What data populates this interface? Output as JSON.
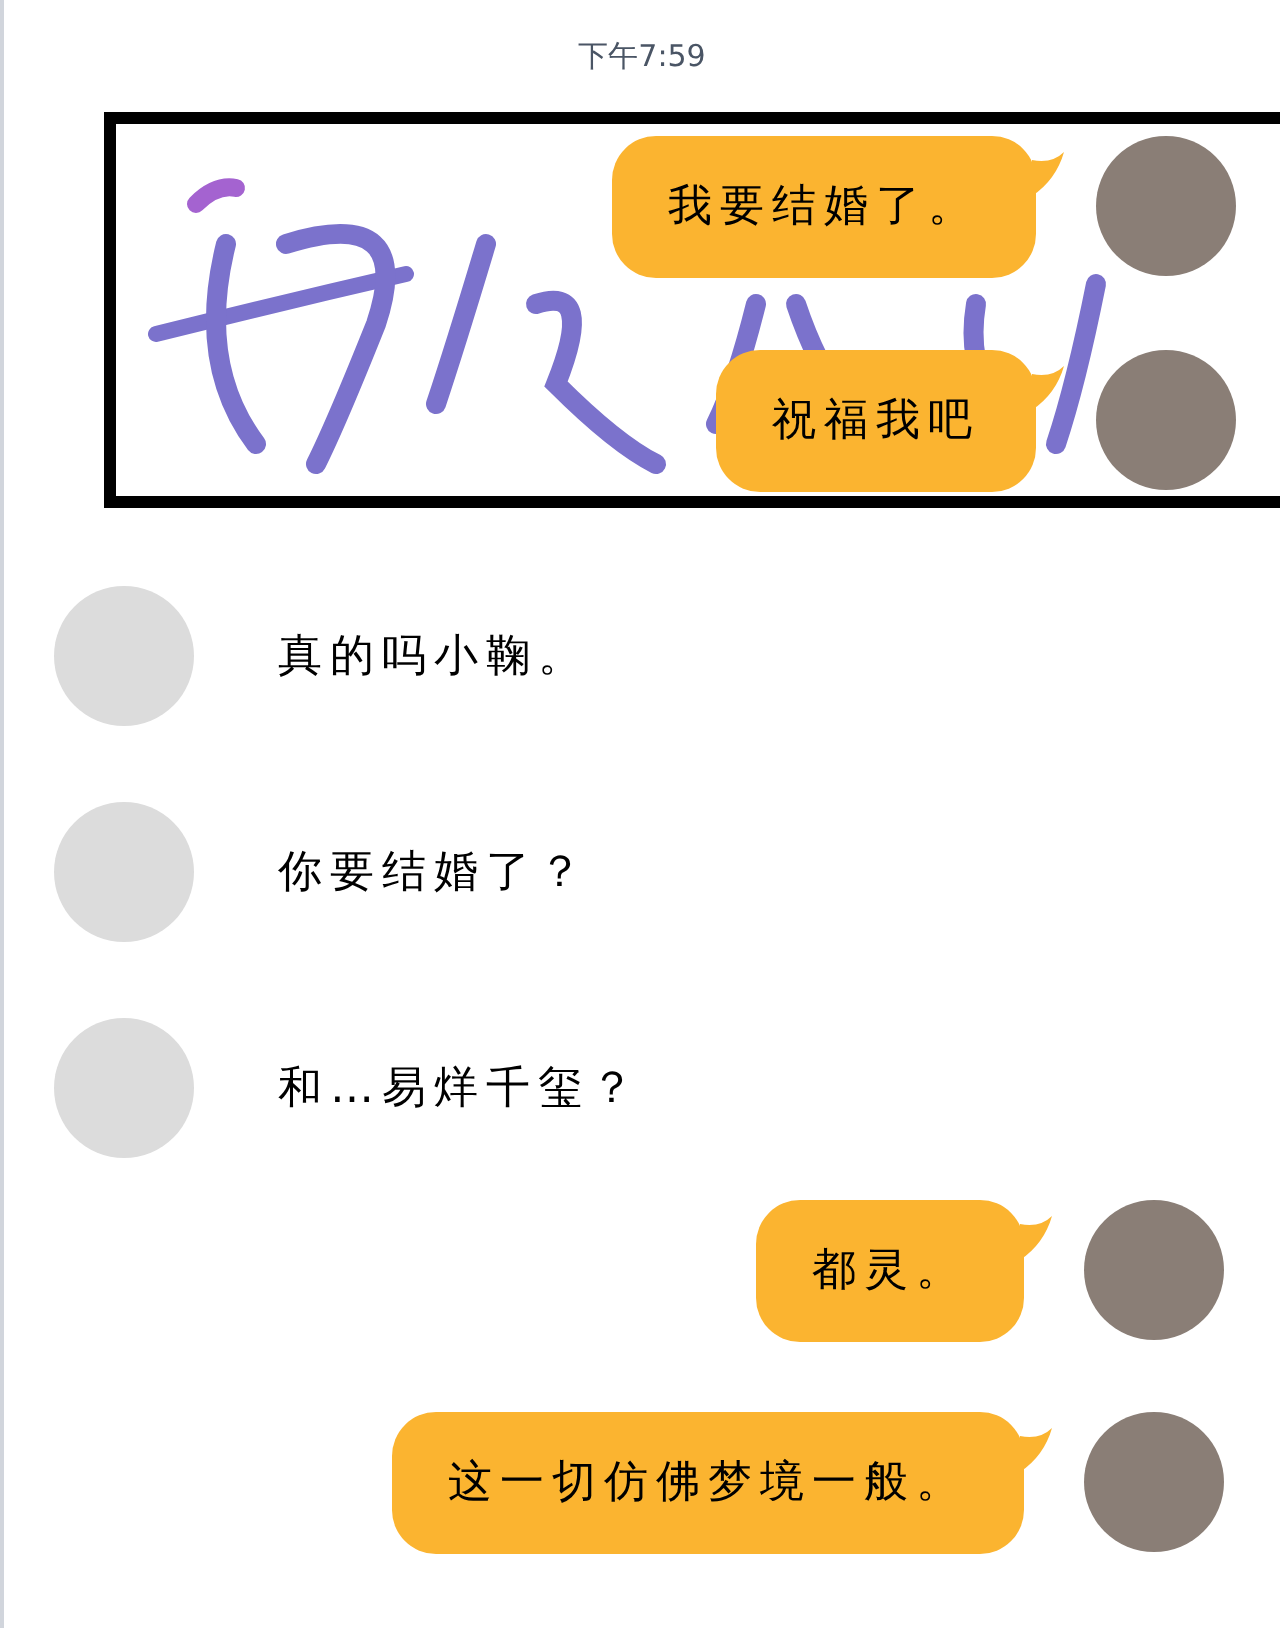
{
  "status_time": "下午7:59",
  "banner": {
    "messages": [
      {
        "kind": "outgoing",
        "text": "我要结婚了。"
      },
      {
        "kind": "outgoing",
        "text": "祝福我吧"
      }
    ]
  },
  "messages": [
    {
      "kind": "incoming",
      "text": "真的吗小鞠。"
    },
    {
      "kind": "incoming",
      "text": "你要结婚了？"
    },
    {
      "kind": "incoming",
      "text": "和…易烊千玺？"
    },
    {
      "kind": "outgoing",
      "text": "都灵。"
    },
    {
      "kind": "outgoing",
      "text": "这一切仿佛梦境一般。"
    }
  ]
}
